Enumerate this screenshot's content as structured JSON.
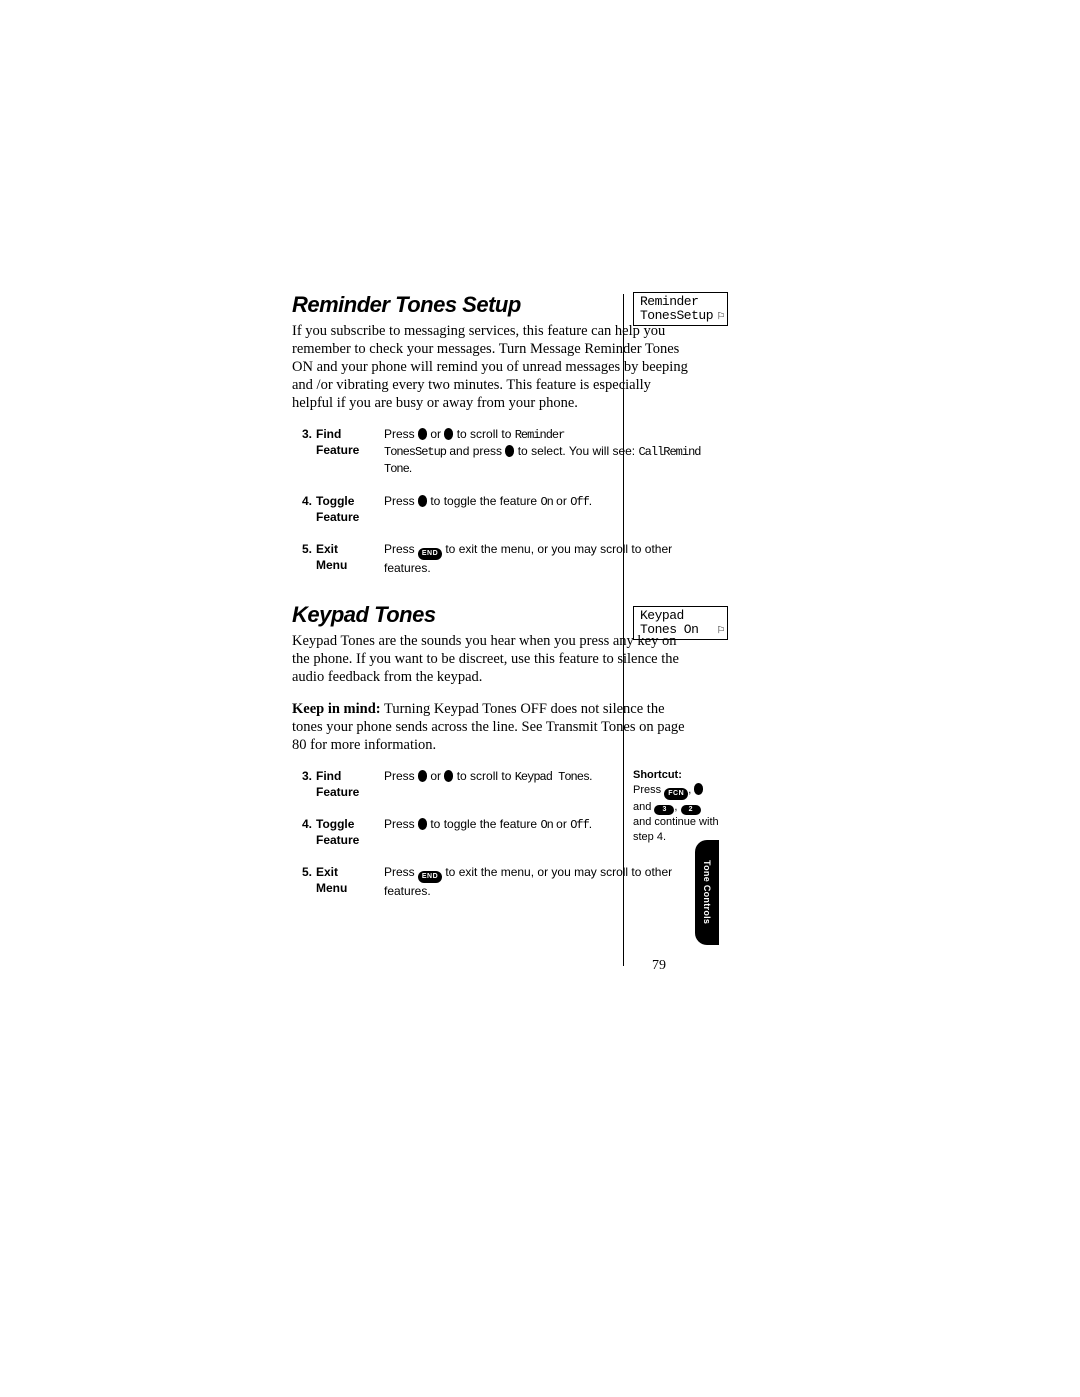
{
  "section1": {
    "heading": "Reminder Tones Setup",
    "paragraph": "If you subscribe to messaging services, this feature can help you remember to check your messages. Turn Message Reminder Tones ON and your phone will remind you of unread messages by beeping and /or vibrating every two minutes. This feature is especially helpful if you are busy or away from your phone.",
    "display_line1": "Reminder",
    "display_line2": "TonesSetup",
    "steps": {
      "s3": {
        "num": "3.",
        "name": "Find",
        "sub": "Feature",
        "t1": "Press ",
        "t2": " or ",
        "t3": " to scroll to ",
        "mono1": "Reminder",
        "line2a": "",
        "mono2": "TonesSetup",
        "line2b": " and press ",
        "line2c": " to select. You will see: ",
        "mono3": "CallRemind Tone",
        "line2d": "."
      },
      "s4": {
        "num": "4.",
        "name": "Toggle",
        "sub": "Feature",
        "t1": "Press ",
        "t2": " to toggle the feature ",
        "mono1": "On",
        "t3": " or ",
        "mono2": "Off",
        "t4": "."
      },
      "s5": {
        "num": "5.",
        "name": "Exit",
        "sub": "Menu",
        "t1": "Press ",
        "end": "END",
        "t2": " to exit the menu, or you may scroll to other features."
      }
    }
  },
  "section2": {
    "heading": "Keypad Tones",
    "paragraph1": "Keypad Tones are the sounds you hear when you press any key on the phone. If you want to be discreet, use this feature to silence the audio feedback from the keypad.",
    "paragraph2_bold": "Keep in mind:",
    "paragraph2_rest": " Turning Keypad Tones OFF does not silence the tones your phone sends across the line. See Transmit Tones on page 80 for more information.",
    "display_line1": "Keypad",
    "display_line2": "Tones On",
    "steps": {
      "s3": {
        "num": "3.",
        "name": "Find",
        "sub": "Feature",
        "t1": "Press ",
        "t2": " or ",
        "t3": " to scroll to ",
        "mono1": "Keypad Tones",
        "t4": "."
      },
      "s4": {
        "num": "4.",
        "name": "Toggle",
        "sub": "Feature",
        "t1": "Press ",
        "t2": " to toggle the feature ",
        "mono1": "On",
        "t3": " or ",
        "mono2": "Off",
        "t4": "."
      },
      "s5": {
        "num": "5.",
        "name": "Exit",
        "sub": "Menu",
        "t1": "Press ",
        "end": "END",
        "t2": " to exit the menu, or you may scroll to other features."
      }
    },
    "shortcut": {
      "title": "Shortcut:",
      "line1a": "Press ",
      "fcn": "FCN",
      "line1b": ", ",
      "line2a": "and ",
      "k3": "3",
      "comma": ", ",
      "k2": "2",
      "rest": "and continue with step 4."
    }
  },
  "page_number": "79",
  "tab_label": "Tone Controls"
}
